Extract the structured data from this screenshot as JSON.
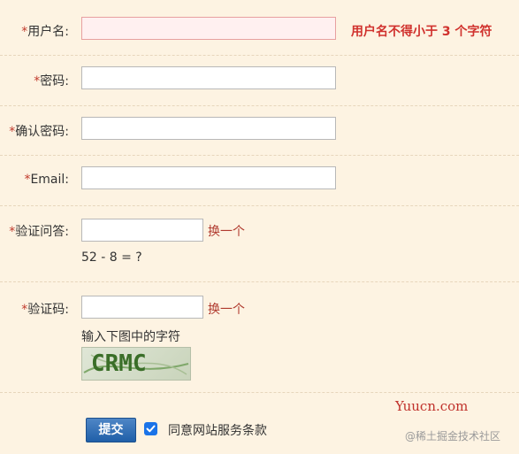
{
  "form": {
    "username": {
      "label": "用户名:",
      "required_mark": "*",
      "value": "",
      "error": "用户名不得小于 3 个字符"
    },
    "password": {
      "label": "密码:",
      "required_mark": "*",
      "value": ""
    },
    "confirm_password": {
      "label": "确认密码:",
      "required_mark": "*",
      "value": ""
    },
    "email": {
      "label": "Email:",
      "required_mark": "*",
      "value": ""
    },
    "security_question": {
      "label": "验证问答:",
      "required_mark": "*",
      "value": "",
      "change_link": "换一个",
      "question": "52 - 8 = ?"
    },
    "captcha": {
      "label": "验证码:",
      "required_mark": "*",
      "value": "",
      "change_link": "换一个",
      "hint": "输入下图中的字符",
      "image_text": "CRMC"
    },
    "submit_label": "提交",
    "agree_checked": true,
    "agree_label": "同意网站服务条款"
  },
  "watermark": {
    "site": "Yuucn.com",
    "community": "@稀土掘金技术社区"
  },
  "colors": {
    "background": "#fdf3e2",
    "error": "#d0312d",
    "link": "#b03a2e",
    "submit": "#1f5fa8",
    "checkbox": "#1a73e8"
  }
}
